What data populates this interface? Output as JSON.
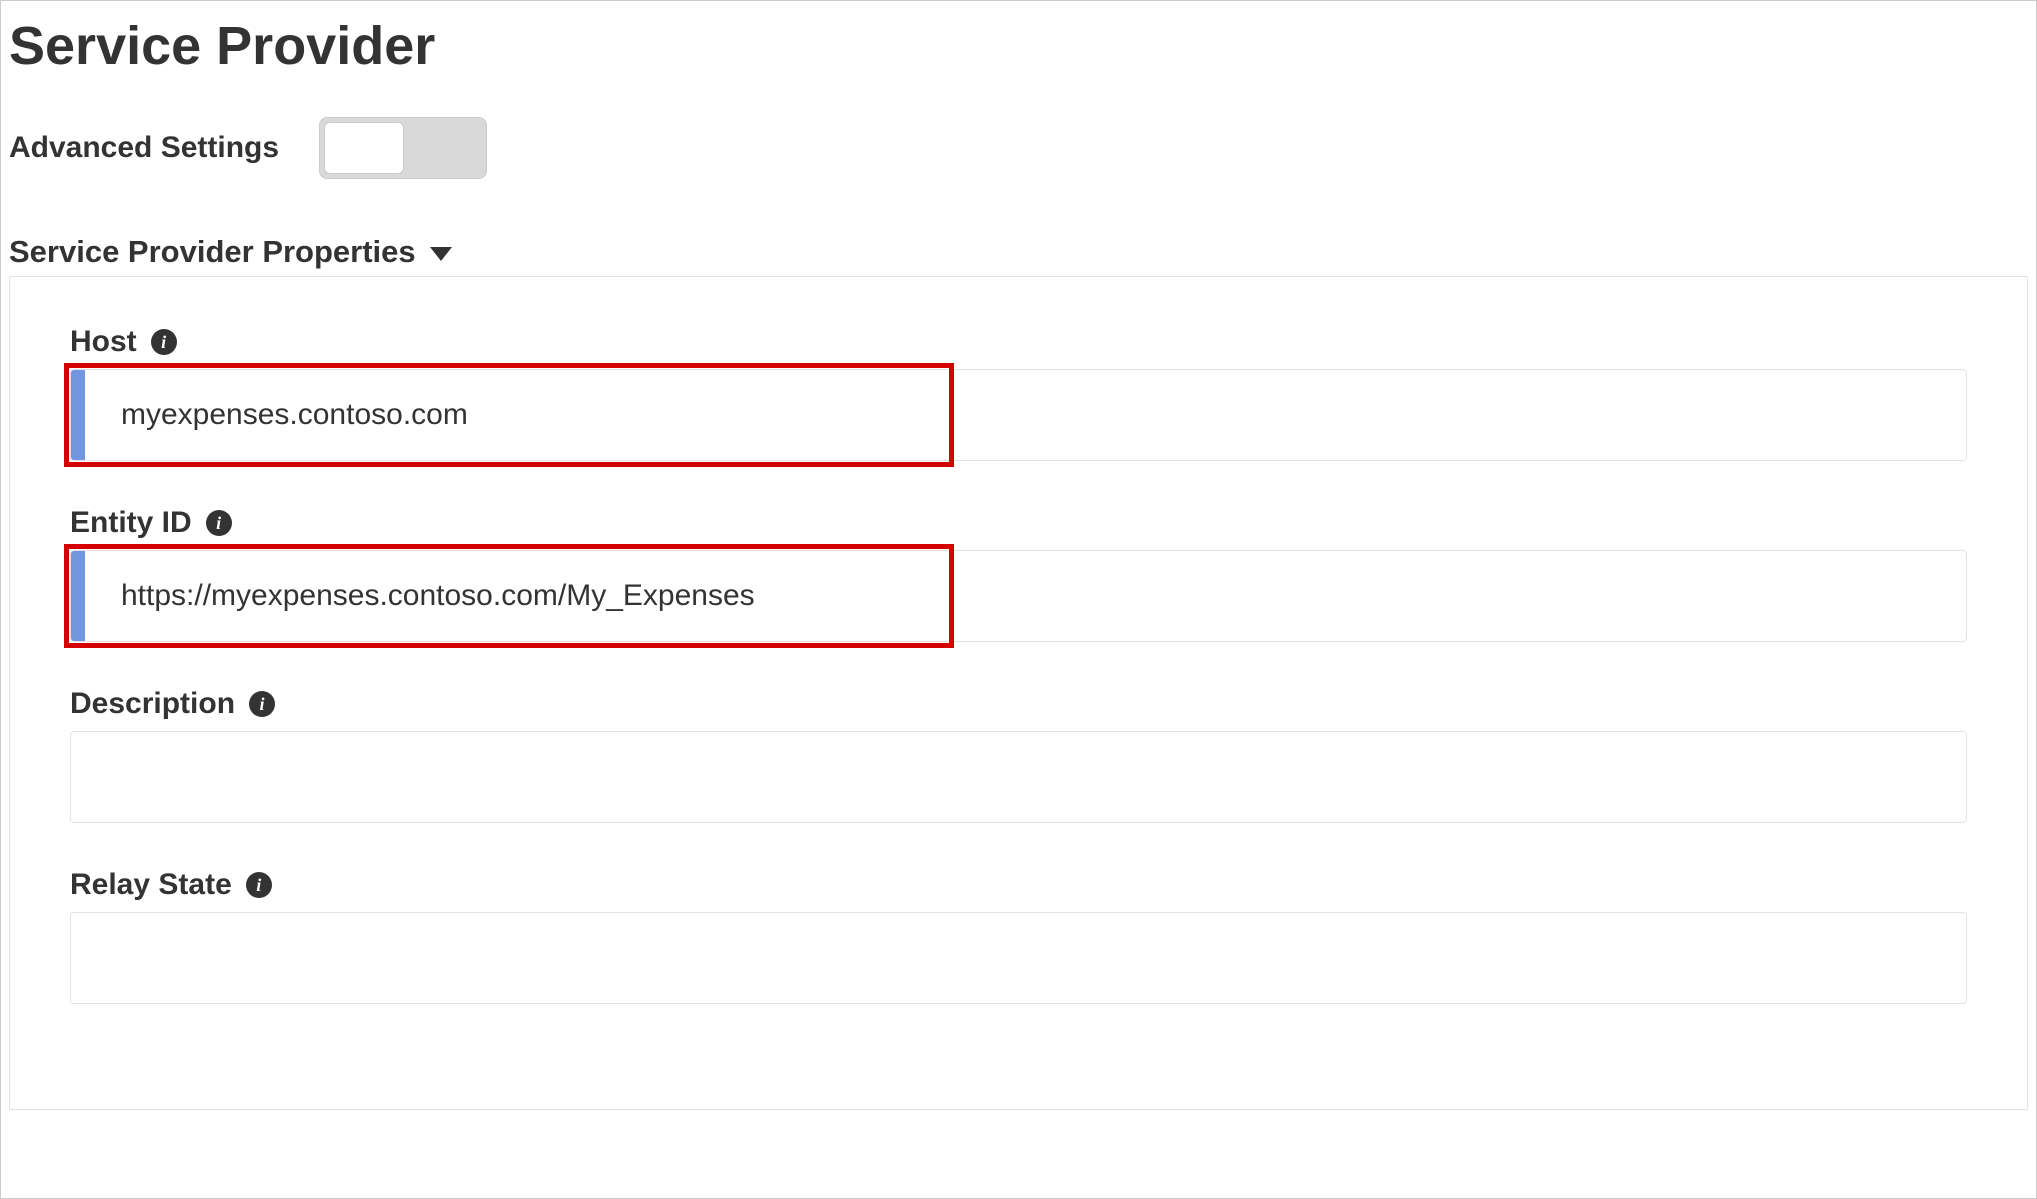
{
  "page": {
    "title": "Service Provider"
  },
  "advanced": {
    "label": "Advanced Settings",
    "enabled": false
  },
  "section": {
    "title": "Service Provider Properties"
  },
  "fields": {
    "host": {
      "label": "Host",
      "value": "myexpenses.contoso.com"
    },
    "entity_id": {
      "label": "Entity ID",
      "value": "https://myexpenses.contoso.com/My_Expenses"
    },
    "description": {
      "label": "Description",
      "value": ""
    },
    "relay_state": {
      "label": "Relay State",
      "value": ""
    }
  },
  "icons": {
    "info_glyph": "i"
  }
}
